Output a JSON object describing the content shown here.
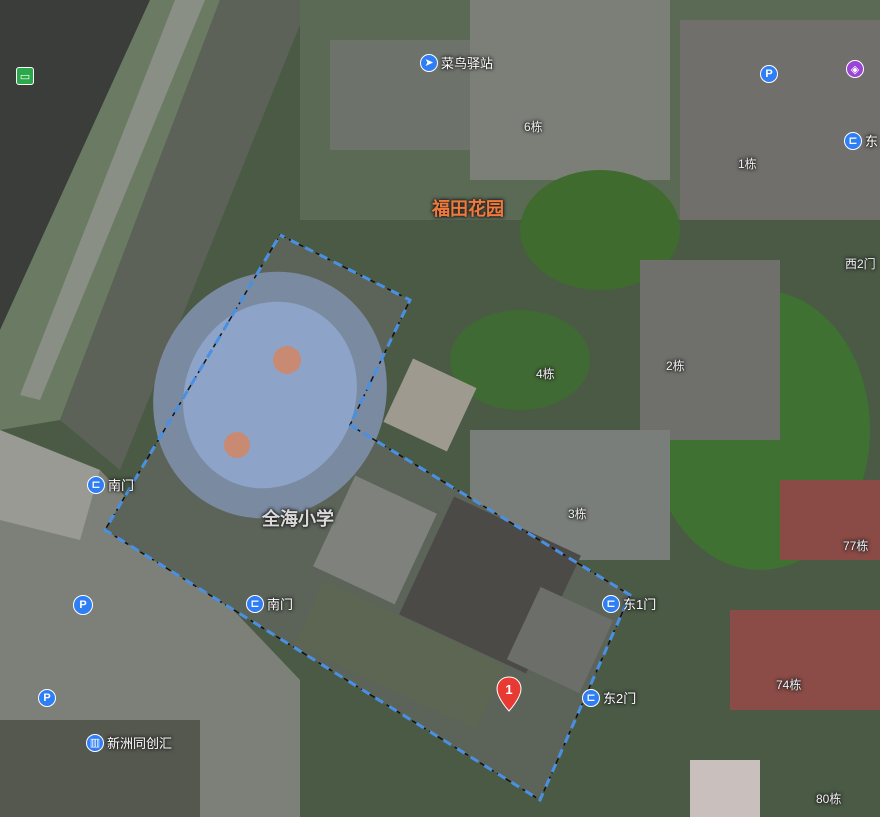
{
  "colors": {
    "boundary_dash": "#4a90e2",
    "school_name": "#d9d9d9",
    "estate_name": "#f07a3c",
    "gate_pin": "#2f7ef5",
    "marker": "#e83a32"
  },
  "estate": {
    "name": "福田花园"
  },
  "school": {
    "name": "全海小学"
  },
  "pois": {
    "cainiao": "菜鸟驿站",
    "xinzhou": "新洲同创汇",
    "east_top": "东"
  },
  "gates": {
    "south_gate_1": "南门",
    "south_gate_2": "南门",
    "east_gate_1": "东1门",
    "east_gate_2": "东2门",
    "west_gate_2": "西2门"
  },
  "buildings": {
    "b6": "6栋",
    "b1": "1栋",
    "b4": "4栋",
    "b2": "2栋",
    "b3": "3栋",
    "b77": "77栋",
    "b74": "74栋",
    "b80": "80栋"
  },
  "marker": {
    "number": "1"
  },
  "icons": [
    "bus-stop-icon",
    "delivery-icon",
    "parking-icon",
    "mall-icon",
    "entrance-icon",
    "office-building-icon",
    "location-marker-icon"
  ]
}
